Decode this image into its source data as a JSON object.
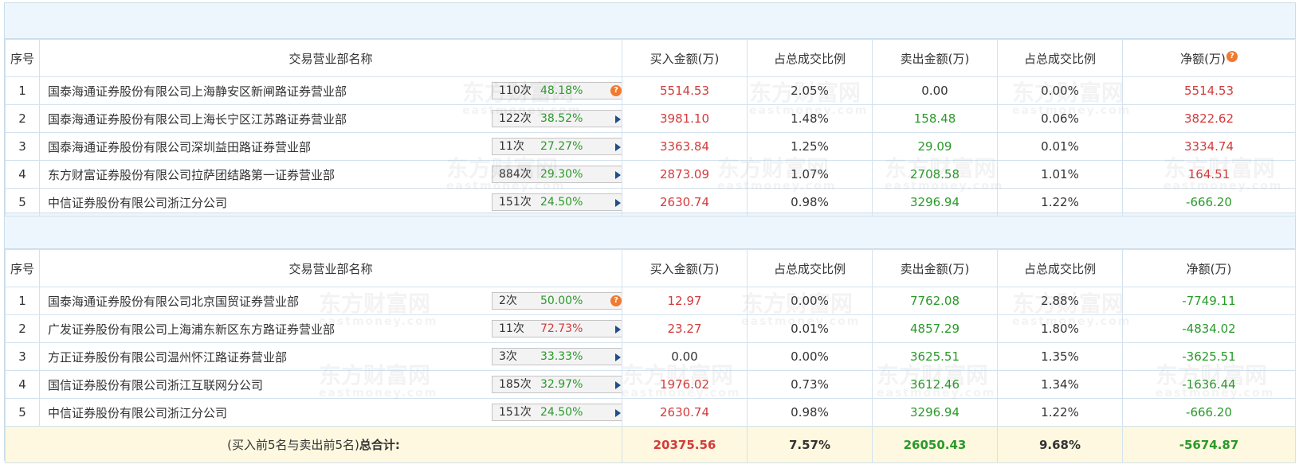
{
  "buy_table": {
    "headers": {
      "index": "序号",
      "name": "交易营业部名称",
      "buy": "买入金额(万)",
      "buy_ratio": "占总成交比例",
      "sell": "卖出金额(万)",
      "sell_ratio": "占总成交比例",
      "net": "净额(万)"
    },
    "rows": [
      {
        "index": "1",
        "name": "国泰海通证券股份有限公司上海静安区新闸路证券营业部",
        "count": "110次",
        "rate": "48.18%",
        "buy": "5514.53",
        "buy_ratio": "2.05%",
        "sell": "0.00",
        "sell_ratio": "0.00%",
        "net": "5514.53"
      },
      {
        "index": "2",
        "name": "国泰海通证券股份有限公司上海长宁区江苏路证券营业部",
        "count": "122次",
        "rate": "38.52%",
        "buy": "3981.10",
        "buy_ratio": "1.48%",
        "sell": "158.48",
        "sell_ratio": "0.06%",
        "net": "3822.62"
      },
      {
        "index": "3",
        "name": "国泰海通证券股份有限公司深圳益田路证券营业部",
        "count": "11次",
        "rate": "27.27%",
        "buy": "3363.84",
        "buy_ratio": "1.25%",
        "sell": "29.09",
        "sell_ratio": "0.01%",
        "net": "3334.74"
      },
      {
        "index": "4",
        "name": "东方财富证券股份有限公司拉萨团结路第一证券营业部",
        "count": "884次",
        "rate": "29.30%",
        "buy": "2873.09",
        "buy_ratio": "1.07%",
        "sell": "2708.58",
        "sell_ratio": "1.01%",
        "net": "164.51"
      },
      {
        "index": "5",
        "name": "中信证券股份有限公司浙江分公司",
        "count": "151次",
        "rate": "24.50%",
        "buy": "2630.74",
        "buy_ratio": "0.98%",
        "sell": "3296.94",
        "sell_ratio": "1.22%",
        "net": "-666.20"
      }
    ]
  },
  "sell_table": {
    "headers": {
      "index": "序号",
      "name": "交易营业部名称",
      "buy": "买入金额(万)",
      "buy_ratio": "占总成交比例",
      "sell": "卖出金额(万)",
      "sell_ratio": "占总成交比例",
      "net": "净额(万)"
    },
    "rows": [
      {
        "index": "1",
        "name": "国泰海通证券股份有限公司北京国贸证券营业部",
        "count": "2次",
        "rate": "50.00%",
        "buy": "12.97",
        "buy_ratio": "0.00%",
        "sell": "7762.08",
        "sell_ratio": "2.88%",
        "net": "-7749.11"
      },
      {
        "index": "2",
        "name": "广发证券股份有限公司上海浦东新区东方路证券营业部",
        "count": "11次",
        "rate": "72.73%",
        "buy": "23.27",
        "buy_ratio": "0.01%",
        "sell": "4857.29",
        "sell_ratio": "1.80%",
        "net": "-4834.02"
      },
      {
        "index": "3",
        "name": "方正证券股份有限公司温州怀江路证券营业部",
        "count": "3次",
        "rate": "33.33%",
        "buy": "0.00",
        "buy_ratio": "0.00%",
        "sell": "3625.51",
        "sell_ratio": "1.35%",
        "net": "-3625.51"
      },
      {
        "index": "4",
        "name": "国信证券股份有限公司浙江互联网分公司",
        "count": "185次",
        "rate": "32.97%",
        "buy": "1976.02",
        "buy_ratio": "0.73%",
        "sell": "3612.46",
        "sell_ratio": "1.34%",
        "net": "-1636.44"
      },
      {
        "index": "5",
        "name": "中信证券股份有限公司浙江分公司",
        "count": "151次",
        "rate": "24.50%",
        "buy": "2630.74",
        "buy_ratio": "0.98%",
        "sell": "3296.94",
        "sell_ratio": "1.22%",
        "net": "-666.20"
      }
    ],
    "total": {
      "label_prefix": "(买入前5名与卖出前5名)",
      "label_bold": "总合计:",
      "buy": "20375.56",
      "buy_ratio": "7.57%",
      "sell": "26050.43",
      "sell_ratio": "9.68%",
      "net": "-5674.87"
    }
  },
  "watermark": {
    "text": "东方财富网",
    "sub": "eastmoney.com"
  },
  "help_icon_glyph": "?",
  "colors": {
    "positive": "#d43b3b",
    "negative": "#2a9a2a",
    "help": "#f07a2f",
    "header_band": "#eef6fd",
    "total_row": "#fdf8df"
  }
}
